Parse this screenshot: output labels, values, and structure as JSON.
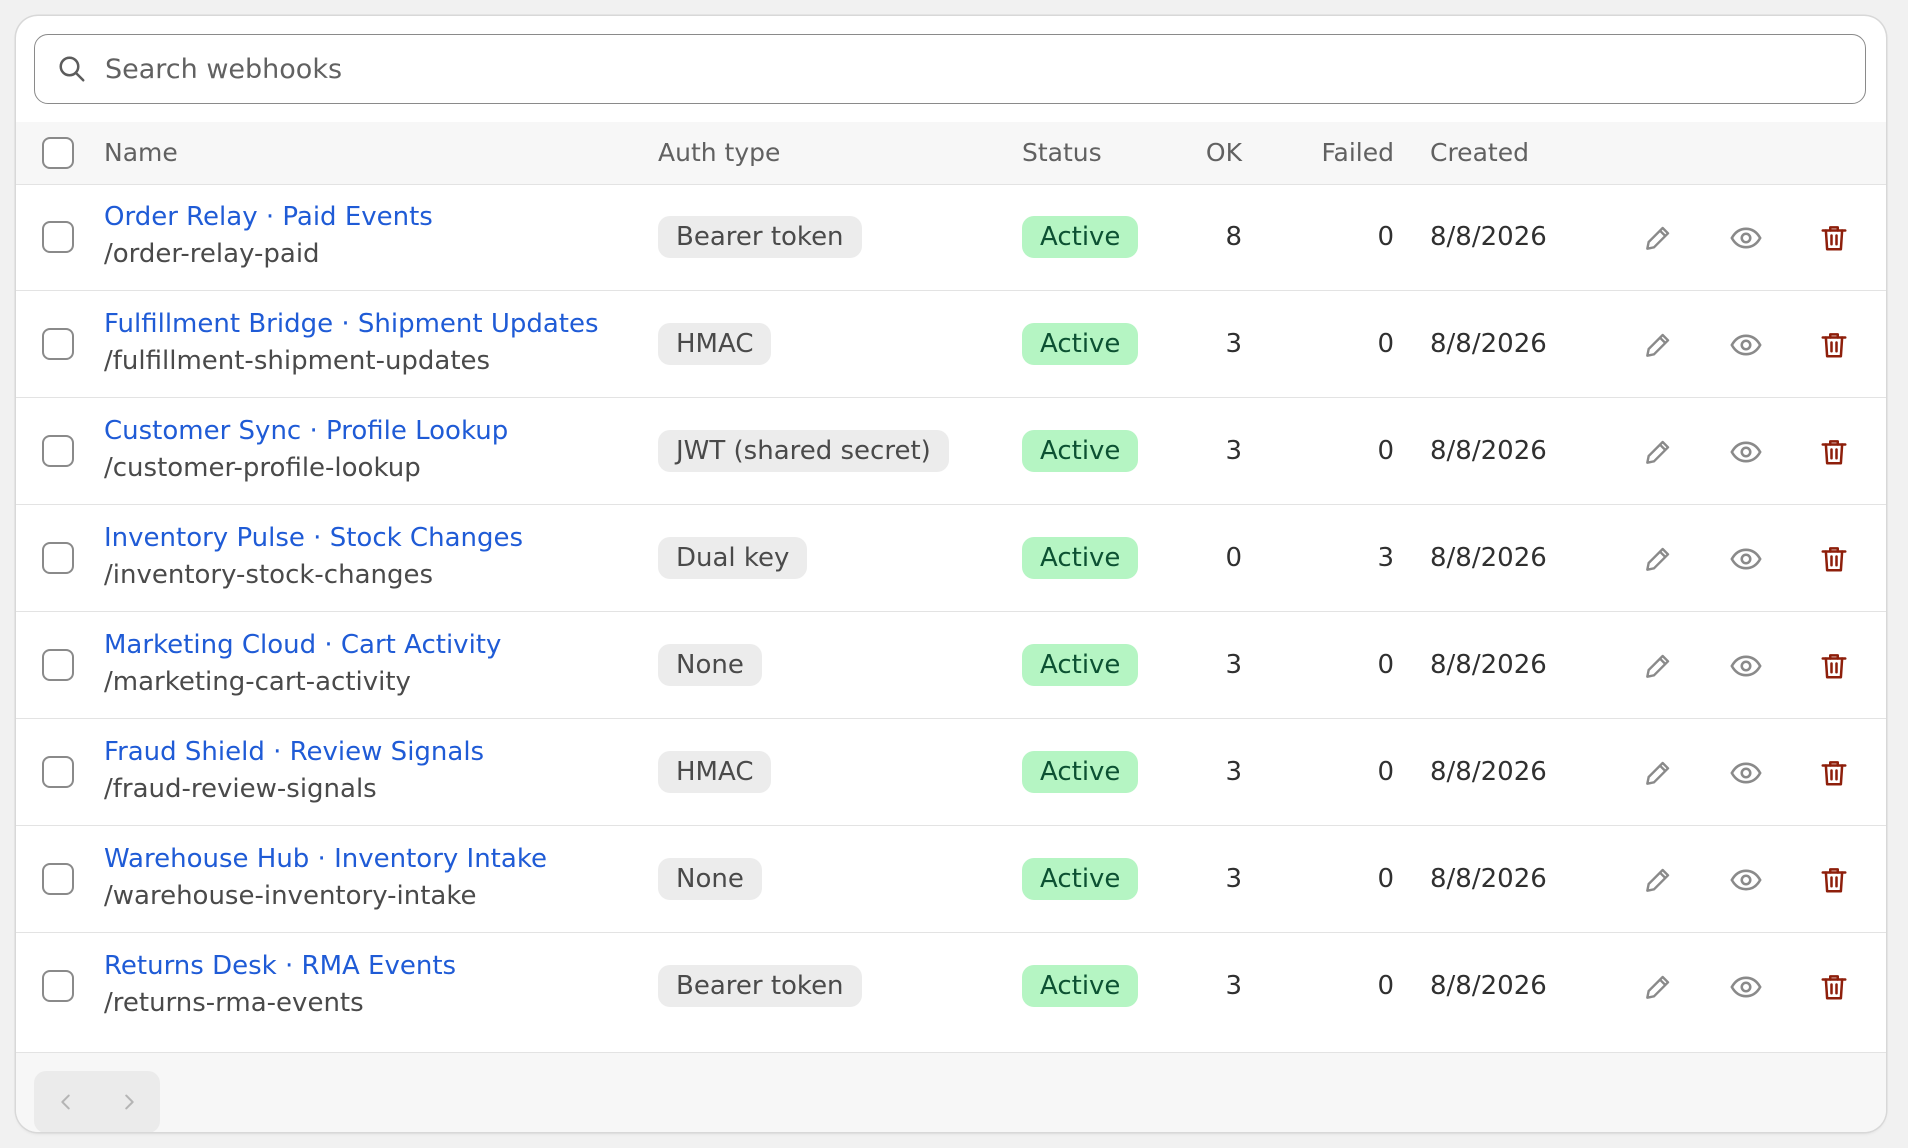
{
  "search": {
    "placeholder": "Search webhooks",
    "icon": "search-icon"
  },
  "table": {
    "columns": {
      "name": "Name",
      "auth": "Auth type",
      "status": "Status",
      "ok": "OK",
      "failed": "Failed",
      "created": "Created"
    },
    "rows": [
      {
        "name": "Order Relay · Paid Events",
        "path": "/order-relay-paid",
        "auth": "Bearer token",
        "status": "Active",
        "ok": "8",
        "failed": "0",
        "created": "8/8/2026"
      },
      {
        "name": "Fulfillment Bridge · Shipment Updates",
        "path": "/fulfillment-shipment-updates",
        "auth": "HMAC",
        "status": "Active",
        "ok": "3",
        "failed": "0",
        "created": "8/8/2026"
      },
      {
        "name": "Customer Sync · Profile Lookup",
        "path": "/customer-profile-lookup",
        "auth": "JWT (shared secret)",
        "status": "Active",
        "ok": "3",
        "failed": "0",
        "created": "8/8/2026"
      },
      {
        "name": "Inventory Pulse · Stock Changes",
        "path": "/inventory-stock-changes",
        "auth": "Dual key",
        "status": "Active",
        "ok": "0",
        "failed": "3",
        "created": "8/8/2026"
      },
      {
        "name": "Marketing Cloud · Cart Activity",
        "path": "/marketing-cart-activity",
        "auth": "None",
        "status": "Active",
        "ok": "3",
        "failed": "0",
        "created": "8/8/2026"
      },
      {
        "name": "Fraud Shield · Review Signals",
        "path": "/fraud-review-signals",
        "auth": "HMAC",
        "status": "Active",
        "ok": "3",
        "failed": "0",
        "created": "8/8/2026"
      },
      {
        "name": "Warehouse Hub · Inventory Intake",
        "path": "/warehouse-inventory-intake",
        "auth": "None",
        "status": "Active",
        "ok": "3",
        "failed": "0",
        "created": "8/8/2026"
      },
      {
        "name": "Returns Desk · RMA Events",
        "path": "/returns-rma-events",
        "auth": "Bearer token",
        "status": "Active",
        "ok": "3",
        "failed": "0",
        "created": "8/8/2026"
      }
    ]
  },
  "colors": {
    "link": "#1f5bd6",
    "status_bg": "#b5f5c3",
    "status_text": "#0c5132",
    "delete_icon": "#8e1f0b",
    "action_icon": "#8a8a8a"
  },
  "icons": {
    "edit": "pencil-icon",
    "view": "eye-icon",
    "delete": "trash-icon",
    "prev": "chevron-left-icon",
    "next": "chevron-right-icon"
  }
}
